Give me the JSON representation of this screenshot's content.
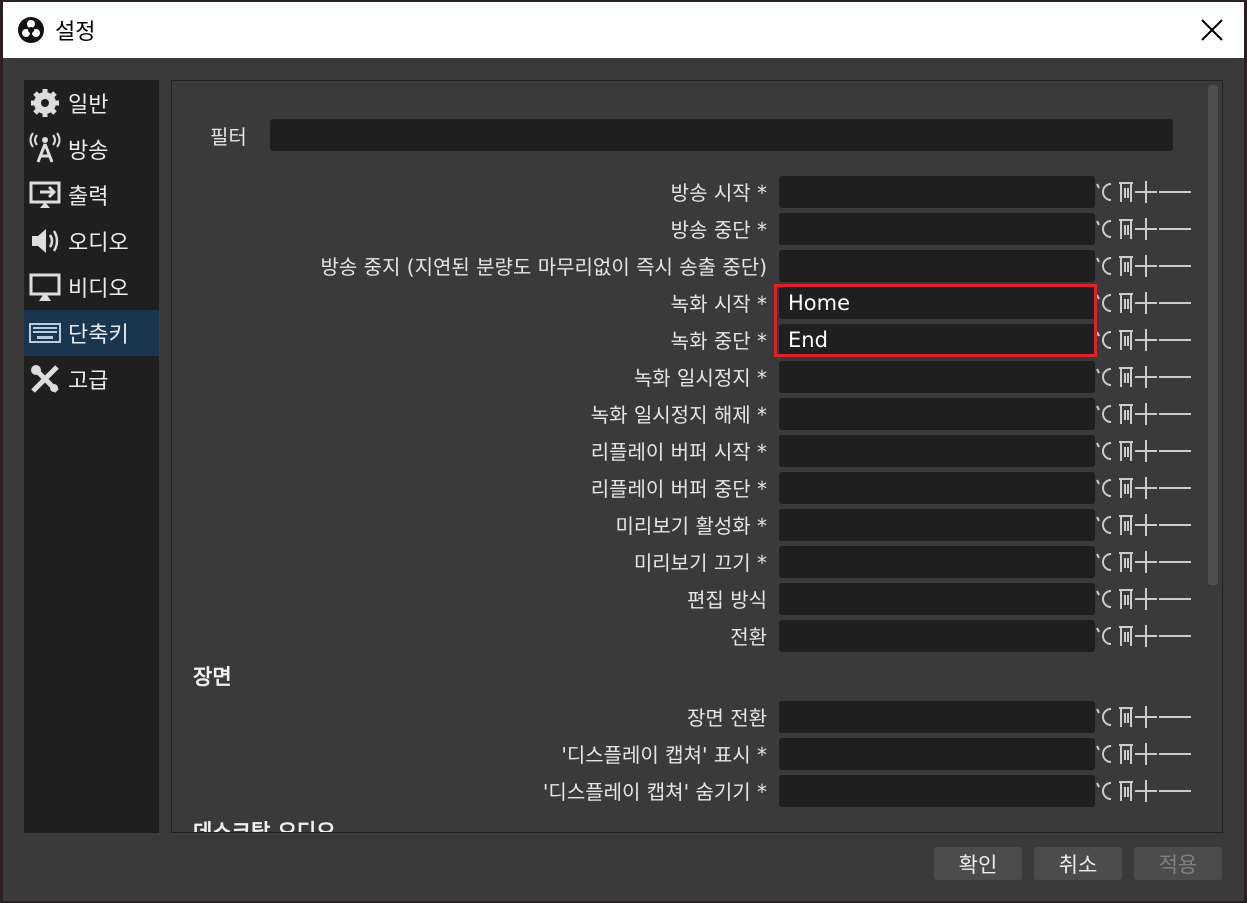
{
  "window": {
    "title": "설정"
  },
  "sidebar": {
    "items": [
      {
        "label": "일반",
        "icon": "gear-icon"
      },
      {
        "label": "방송",
        "icon": "antenna-icon"
      },
      {
        "label": "출력",
        "icon": "output-icon"
      },
      {
        "label": "오디오",
        "icon": "speaker-icon"
      },
      {
        "label": "비디오",
        "icon": "monitor-icon"
      },
      {
        "label": "단축키",
        "icon": "keyboard-icon",
        "active": true
      },
      {
        "label": "고급",
        "icon": "tools-icon"
      }
    ]
  },
  "filter": {
    "label": "필터",
    "value": ""
  },
  "hotkeys": [
    {
      "label": "방송 시작 *",
      "value": ""
    },
    {
      "label": "방송 중단 *",
      "value": ""
    },
    {
      "label": "방송 중지 (지연된 분량도 마무리없이 즉시 송출 중단)",
      "value": ""
    },
    {
      "label": "녹화 시작 *",
      "value": "Home"
    },
    {
      "label": "녹화 중단 *",
      "value": "End"
    },
    {
      "label": "녹화 일시정지 *",
      "value": ""
    },
    {
      "label": "녹화 일시정지 해제 *",
      "value": ""
    },
    {
      "label": "리플레이 버퍼 시작 *",
      "value": ""
    },
    {
      "label": "리플레이 버퍼 중단 *",
      "value": ""
    },
    {
      "label": "미리보기 활성화 *",
      "value": ""
    },
    {
      "label": "미리보기 끄기 *",
      "value": ""
    },
    {
      "label": "편집 방식",
      "value": ""
    },
    {
      "label": "전환",
      "value": ""
    }
  ],
  "scene_section": {
    "title": "장면",
    "hotkeys": [
      {
        "label": "장면 전환",
        "value": ""
      },
      {
        "label": "'디스플레이 캡쳐' 표시 *",
        "value": ""
      },
      {
        "label": "'디스플레이 캡쳐' 숨기기 *",
        "value": ""
      }
    ]
  },
  "desktop_audio_section": {
    "title": "데스크탑 오디오"
  },
  "buttons": {
    "ok": "확인",
    "cancel": "취소",
    "apply": "적용"
  }
}
